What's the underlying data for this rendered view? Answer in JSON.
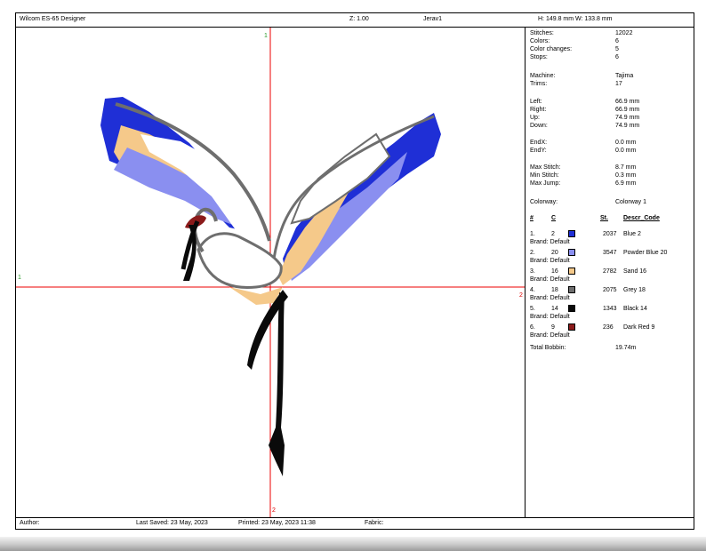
{
  "header": {
    "app_title": "Wilcom ES-65 Designer",
    "zoom": "Z: 1.00",
    "design_name": "Jerav1",
    "size": "H: 149.8 mm  W: 133.8 mm"
  },
  "axis_labels": {
    "top": "1",
    "left": "1",
    "right": "2",
    "bottom": "2"
  },
  "stats": [
    {
      "label": "Stitches:",
      "value": "12022"
    },
    {
      "label": "Colors:",
      "value": "6"
    },
    {
      "label": "Color changes:",
      "value": "5"
    },
    {
      "label": "Stops:",
      "value": "6"
    },
    {
      "label": "Machine:",
      "value": "Tajima"
    },
    {
      "label": "Trims:",
      "value": "17"
    },
    {
      "label": "Left:",
      "value": "66.9 mm"
    },
    {
      "label": "Right:",
      "value": "66.9 mm"
    },
    {
      "label": "Up:",
      "value": "74.9 mm"
    },
    {
      "label": "Down:",
      "value": "74.9 mm"
    },
    {
      "label": "EndX:",
      "value": "0.0 mm"
    },
    {
      "label": "EndY:",
      "value": "0.0 mm"
    },
    {
      "label": "Max Stitch:",
      "value": "8.7 mm"
    },
    {
      "label": "Min Stitch:",
      "value": "0.3 mm"
    },
    {
      "label": "Max Jump:",
      "value": "6.9 mm"
    },
    {
      "label": "Colorway:",
      "value": "Colorway 1"
    }
  ],
  "color_table": {
    "headers": {
      "num": "#",
      "color": "C",
      "stitches": "St.",
      "descr": "Descr_Code"
    },
    "brand_label": "Brand: Default",
    "rows": [
      {
        "num": "1.",
        "code": "2",
        "stitches": "2037",
        "descr": "Blue 2",
        "color": "#1f2fd6"
      },
      {
        "num": "2.",
        "code": "20",
        "stitches": "3547",
        "descr": "Powder Blue 20",
        "color": "#8a8ff0"
      },
      {
        "num": "3.",
        "code": "16",
        "stitches": "2782",
        "descr": "Sand 16",
        "color": "#f5c98a"
      },
      {
        "num": "4.",
        "code": "18",
        "stitches": "2075",
        "descr": "Grey 18",
        "color": "#6e6e6e"
      },
      {
        "num": "5.",
        "code": "14",
        "stitches": "1343",
        "descr": "Black 14",
        "color": "#0a0a0a"
      },
      {
        "num": "6.",
        "code": "9",
        "stitches": "236",
        "descr": "Dark Red 9",
        "color": "#8b1a1a"
      }
    ],
    "total_bobbin_label": "Total Bobbin:",
    "total_bobbin_value": "19.74m"
  },
  "footer": {
    "author": "Author:",
    "last_saved": "Last Saved: 23 May, 2023",
    "printed": "Printed: 23 May, 2023 11:38",
    "fabric": "Fabric:"
  }
}
